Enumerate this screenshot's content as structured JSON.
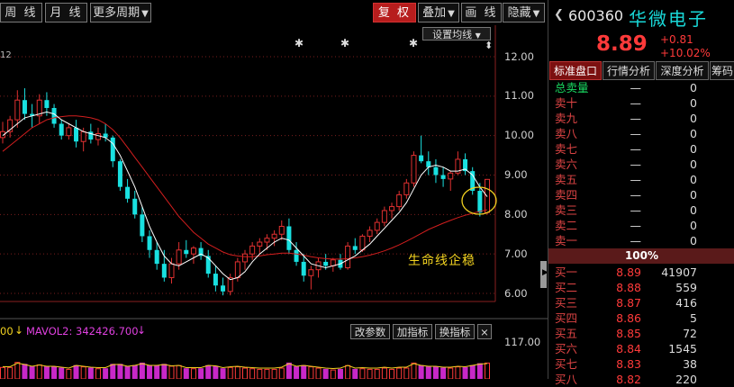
{
  "toolbar": {
    "weekly": "周 线",
    "monthly": "月 线",
    "more_periods": "更多周期",
    "restore_rights": "复 权",
    "overlay": "叠加",
    "draw_line": "画 线",
    "hide": "隐藏"
  },
  "chart": {
    "corner_label": "12",
    "ma_settings": "设置均线",
    "annotation": "生命线企稳",
    "price_ticks": [
      "12.00",
      "11.00",
      "10.00",
      "9.00",
      "8.00",
      "7.00",
      "6.00"
    ],
    "volume_tick": "117.00",
    "arrow_glyph": "⬍"
  },
  "chart_data": {
    "type": "candlestick",
    "ylim": [
      5.8,
      12.3
    ],
    "price_ticks": [
      12,
      11,
      10,
      9,
      8,
      7,
      6
    ],
    "candles": [
      [
        9.95,
        10.35,
        9.8,
        10.1
      ],
      [
        10.1,
        10.5,
        9.95,
        10.4
      ],
      [
        10.4,
        11.15,
        10.2,
        10.9
      ],
      [
        10.9,
        11.2,
        10.4,
        10.55
      ],
      [
        10.55,
        10.8,
        10.2,
        10.5
      ],
      [
        10.5,
        11.05,
        10.3,
        10.9
      ],
      [
        10.9,
        11.1,
        10.5,
        10.7
      ],
      [
        10.7,
        10.8,
        10.2,
        10.3
      ],
      [
        10.3,
        10.4,
        9.9,
        10.0
      ],
      [
        10.0,
        10.3,
        9.9,
        10.2
      ],
      [
        10.2,
        10.4,
        9.7,
        9.85
      ],
      [
        9.85,
        10.2,
        9.6,
        10.1
      ],
      [
        10.1,
        10.3,
        9.8,
        9.9
      ],
      [
        9.9,
        10.2,
        9.75,
        10.05
      ],
      [
        10.05,
        10.3,
        9.85,
        9.95
      ],
      [
        9.95,
        10.0,
        9.2,
        9.35
      ],
      [
        9.35,
        9.4,
        8.6,
        8.7
      ],
      [
        8.7,
        8.9,
        8.3,
        8.4
      ],
      [
        8.4,
        8.6,
        7.9,
        8.0
      ],
      [
        8.0,
        8.2,
        7.3,
        7.45
      ],
      [
        7.45,
        7.6,
        6.9,
        7.1
      ],
      [
        7.1,
        7.3,
        6.6,
        6.75
      ],
      [
        6.75,
        7.1,
        6.3,
        6.4
      ],
      [
        6.4,
        6.9,
        6.25,
        6.75
      ],
      [
        6.75,
        7.3,
        6.6,
        7.1
      ],
      [
        7.1,
        7.35,
        6.9,
        7.0
      ],
      [
        7.0,
        7.2,
        6.75,
        7.15
      ],
      [
        7.15,
        7.3,
        6.85,
        6.95
      ],
      [
        6.95,
        7.1,
        6.4,
        6.5
      ],
      [
        6.5,
        6.7,
        6.05,
        6.2
      ],
      [
        6.2,
        6.4,
        5.95,
        6.05
      ],
      [
        6.05,
        6.5,
        5.95,
        6.4
      ],
      [
        6.4,
        6.9,
        6.3,
        6.8
      ],
      [
        6.8,
        7.1,
        6.6,
        7.0
      ],
      [
        7.0,
        7.3,
        6.85,
        7.2
      ],
      [
        7.2,
        7.4,
        7.0,
        7.3
      ],
      [
        7.3,
        7.5,
        7.1,
        7.4
      ],
      [
        7.4,
        7.6,
        7.2,
        7.5
      ],
      [
        7.5,
        7.85,
        7.35,
        7.7
      ],
      [
        7.7,
        7.9,
        7.0,
        7.1
      ],
      [
        7.1,
        7.3,
        6.7,
        6.8
      ],
      [
        6.8,
        7.0,
        6.3,
        6.45
      ],
      [
        6.45,
        6.7,
        6.1,
        6.6
      ],
      [
        6.6,
        6.9,
        6.4,
        6.8
      ],
      [
        6.8,
        7.0,
        6.6,
        6.7
      ],
      [
        6.7,
        6.9,
        6.55,
        6.85
      ],
      [
        6.85,
        7.0,
        6.6,
        6.65
      ],
      [
        6.65,
        7.3,
        6.6,
        7.2
      ],
      [
        7.2,
        7.4,
        7.0,
        7.1
      ],
      [
        7.1,
        7.5,
        7.05,
        7.45
      ],
      [
        7.45,
        7.7,
        7.3,
        7.6
      ],
      [
        7.6,
        7.9,
        7.5,
        7.8
      ],
      [
        7.8,
        8.2,
        7.7,
        8.1
      ],
      [
        8.1,
        8.3,
        7.9,
        8.2
      ],
      [
        8.2,
        8.6,
        8.1,
        8.5
      ],
      [
        8.5,
        8.9,
        8.4,
        8.8
      ],
      [
        8.8,
        9.6,
        8.7,
        9.5
      ],
      [
        9.5,
        10.0,
        9.3,
        9.35
      ],
      [
        9.35,
        9.6,
        9.0,
        9.2
      ],
      [
        9.2,
        9.4,
        8.8,
        9.0
      ],
      [
        9.0,
        9.2,
        8.7,
        8.9
      ],
      [
        8.9,
        9.1,
        8.6,
        9.05
      ],
      [
        9.05,
        9.6,
        9.0,
        9.4
      ],
      [
        9.4,
        9.55,
        9.0,
        9.1
      ],
      [
        9.1,
        9.2,
        8.5,
        8.6
      ],
      [
        8.6,
        8.8,
        7.95,
        8.05
      ],
      [
        8.05,
        8.9,
        8.0,
        8.89
      ]
    ],
    "ma_fast": [
      10.0,
      10.15,
      10.3,
      10.45,
      10.5,
      10.55,
      10.6,
      10.55,
      10.4,
      10.3,
      10.2,
      10.1,
      10.05,
      10.0,
      9.95,
      9.8,
      9.5,
      9.1,
      8.7,
      8.2,
      7.7,
      7.3,
      6.95,
      6.75,
      6.7,
      6.8,
      6.9,
      7.0,
      6.9,
      6.7,
      6.5,
      6.35,
      6.4,
      6.55,
      6.8,
      7.0,
      7.15,
      7.3,
      7.4,
      7.35,
      7.15,
      6.95,
      6.75,
      6.7,
      6.65,
      6.7,
      6.75,
      6.85,
      6.95,
      7.1,
      7.25,
      7.45,
      7.65,
      7.85,
      8.05,
      8.3,
      8.65,
      9.0,
      9.2,
      9.25,
      9.2,
      9.1,
      9.1,
      9.15,
      9.0,
      8.7,
      8.45
    ],
    "ma_life": [
      9.6,
      9.75,
      9.9,
      10.05,
      10.2,
      10.3,
      10.4,
      10.45,
      10.48,
      10.5,
      10.5,
      10.48,
      10.45,
      10.4,
      10.3,
      10.15,
      9.95,
      9.7,
      9.45,
      9.2,
      8.95,
      8.7,
      8.45,
      8.2,
      7.95,
      7.75,
      7.55,
      7.4,
      7.25,
      7.15,
      7.05,
      6.98,
      6.95,
      6.93,
      6.93,
      6.95,
      6.98,
      7.0,
      7.02,
      7.02,
      7.0,
      6.97,
      6.93,
      6.9,
      6.88,
      6.87,
      6.87,
      6.88,
      6.9,
      6.93,
      6.97,
      7.02,
      7.08,
      7.15,
      7.23,
      7.32,
      7.42,
      7.52,
      7.62,
      7.7,
      7.78,
      7.85,
      7.92,
      7.98,
      8.03,
      8.08,
      8.12
    ]
  },
  "indicator_bar": {
    "left_value": "00",
    "ma_vol2_label": "MAVOL2: 342426.700",
    "modify_params": "改参数",
    "add_indicator": "加指标",
    "switch_indicator": "换指标",
    "close": "×"
  },
  "quote": {
    "code": "600360",
    "name": "华微电子",
    "price": "8.89",
    "change": "+0.81",
    "change_pct": "+10.02%"
  },
  "tabs": [
    "标准盘口",
    "行情分析",
    "深度分析",
    "筹码"
  ],
  "orderbook": {
    "total_sell_label": "总卖量",
    "total_sell_price": "—",
    "total_sell_value": "0",
    "sell": [
      {
        "label": "卖十",
        "price": "—",
        "vol": "0"
      },
      {
        "label": "卖九",
        "price": "—",
        "vol": "0"
      },
      {
        "label": "卖八",
        "price": "—",
        "vol": "0"
      },
      {
        "label": "卖七",
        "price": "—",
        "vol": "0"
      },
      {
        "label": "卖六",
        "price": "—",
        "vol": "0"
      },
      {
        "label": "卖五",
        "price": "—",
        "vol": "0"
      },
      {
        "label": "卖四",
        "price": "—",
        "vol": "0"
      },
      {
        "label": "卖三",
        "price": "—",
        "vol": "0"
      },
      {
        "label": "卖二",
        "price": "—",
        "vol": "0"
      },
      {
        "label": "卖一",
        "price": "—",
        "vol": "0"
      }
    ],
    "ratio": "100%",
    "buy": [
      {
        "label": "买一",
        "price": "8.89",
        "vol": "41907"
      },
      {
        "label": "买二",
        "price": "8.88",
        "vol": "559"
      },
      {
        "label": "买三",
        "price": "8.87",
        "vol": "416"
      },
      {
        "label": "买四",
        "price": "8.86",
        "vol": "5"
      },
      {
        "label": "买五",
        "price": "8.85",
        "vol": "72"
      },
      {
        "label": "买六",
        "price": "8.84",
        "vol": "1545"
      },
      {
        "label": "买七",
        "price": "8.83",
        "vol": "38"
      },
      {
        "label": "买八",
        "price": "8.82",
        "vol": "220"
      }
    ]
  },
  "colors": {
    "up": "#e03030",
    "down": "#19e0e0",
    "ma_fast": "#ffffff",
    "ma_life": "#d21e1e",
    "annotation": "#f2d220",
    "accent_name": "#19d8d8"
  }
}
